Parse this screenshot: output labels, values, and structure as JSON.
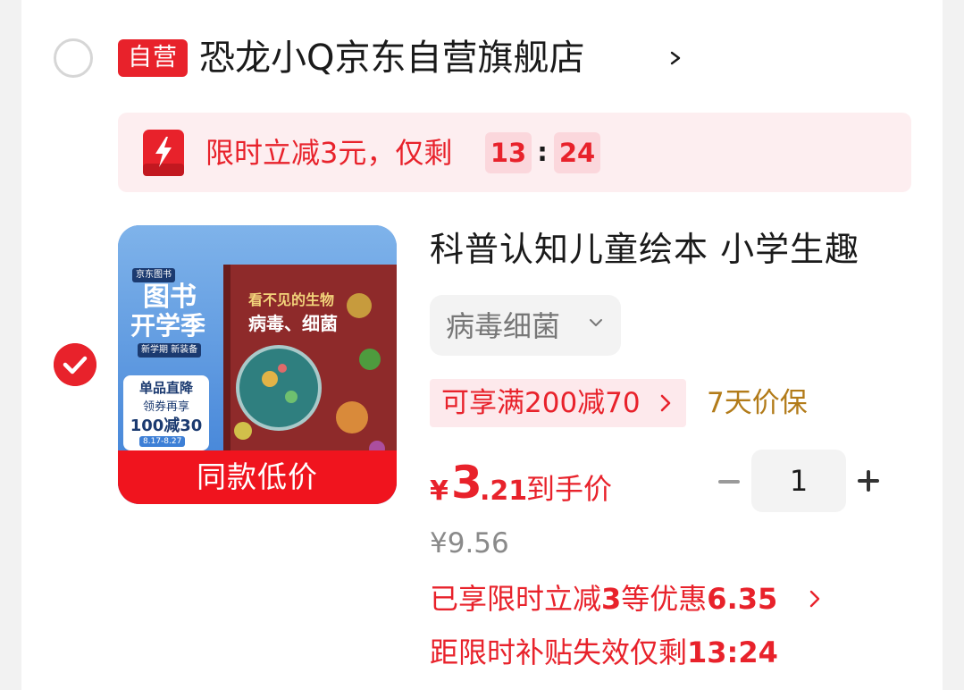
{
  "store": {
    "badge": "自营",
    "name": "恐龙小Q京东自营旗舰店"
  },
  "promo": {
    "text": "限时立减3元，仅剩",
    "countdown_min": "13",
    "countdown_sep": ":",
    "countdown_sec": "24"
  },
  "product": {
    "image_badge": "同款低价",
    "image_texts": {
      "jd_books": "京东图书",
      "season_line1": "图书",
      "season_line2": "开学季",
      "sub": "新学期 新装备",
      "deal_title": "单品直降",
      "deal_sub": "领券再享",
      "deal_amount": "100减30",
      "deal_date": "8.17-8.27",
      "book_title_top": "看不见的生物",
      "book_title_bottom": "病毒、细菌"
    },
    "title": "科普认知儿童绘本 小学生趣",
    "variant": "病毒细菌",
    "coupon": "可享满200减70",
    "guarantee": "7天价保",
    "price_currency": "¥",
    "price_int": "3",
    "price_dec": ".21",
    "price_label": "到手价",
    "quantity": "1",
    "original_price": "¥9.56",
    "discount_prefix": "已享限时立减",
    "discount_num": "3",
    "discount_mid": "等优惠",
    "discount_amount": "6.35",
    "subsidy_prefix": "距限时补贴失效仅剩",
    "subsidy_time": "13:24"
  },
  "colors": {
    "accent_red": "#e8222b",
    "gold": "#b27b19",
    "promo_bg": "#fdeef0"
  },
  "icons": {
    "store_radio": "radio-unchecked",
    "item_check": "checkmark-circle",
    "bolt": "lightning-bolt",
    "chevrons": "chevron-right",
    "variant_chevron": "chevron-down"
  }
}
